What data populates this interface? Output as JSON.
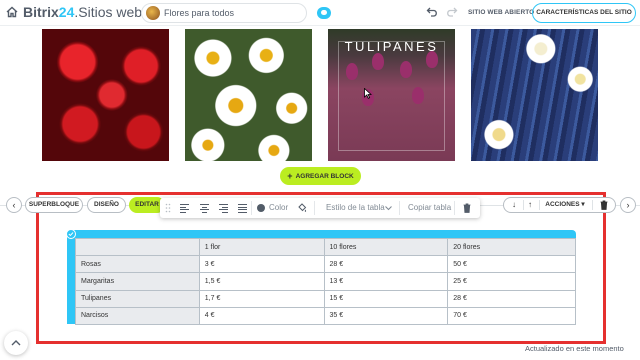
{
  "header": {
    "brand_part1": "Bitrix",
    "brand_part2": "24",
    "brand_part3": ".Sitios web",
    "site_name": "Flores para todos",
    "open_site": "SITIO WEB ABIERTO",
    "site_settings": "CARACTERÍSTICAS DEL SITIO"
  },
  "gallery": {
    "tulip_title": "TULIPANES"
  },
  "add_block": "AGREGAR BLOCK",
  "block_toolbar": {
    "superblock": "SUPERBLOQUE",
    "design": "DISEÑO",
    "edit": "EDITAR",
    "color": "Color",
    "table_style": "Estilo de la tabla",
    "copy_table": "Copiar tabla",
    "actions": "ACCIONES"
  },
  "table": {
    "headers": [
      "",
      "1 flor",
      "10 flores",
      "20 flores"
    ],
    "rows": [
      [
        "Rosas",
        "3 €",
        "28 €",
        "50 €"
      ],
      [
        "Margaritas",
        "1,5 €",
        "13 €",
        "25 €"
      ],
      [
        "Tulipanes",
        "1,7 €",
        "15 €",
        "28 €"
      ],
      [
        "Narcisos",
        "4 €",
        "35 €",
        "70 €"
      ]
    ]
  },
  "status": "Actualizado en este momento",
  "colors": {
    "accent_blue": "#2fc6f6",
    "lime": "#bbed21",
    "highlight_red": "#e5302f"
  },
  "icons": [
    "home-icon",
    "cloud-icon",
    "undo-icon",
    "redo-icon",
    "arrow-left-icon",
    "arrow-right-icon",
    "drag-handle-icon",
    "align-left-icon",
    "align-center-icon",
    "align-right-icon",
    "align-justify-icon",
    "color-dot-icon",
    "paint-bucket-icon",
    "chevron-down-icon",
    "trash-icon",
    "arrow-down-icon",
    "arrow-up-icon",
    "check-icon",
    "scroll-up-icon",
    "cursor-icon"
  ]
}
